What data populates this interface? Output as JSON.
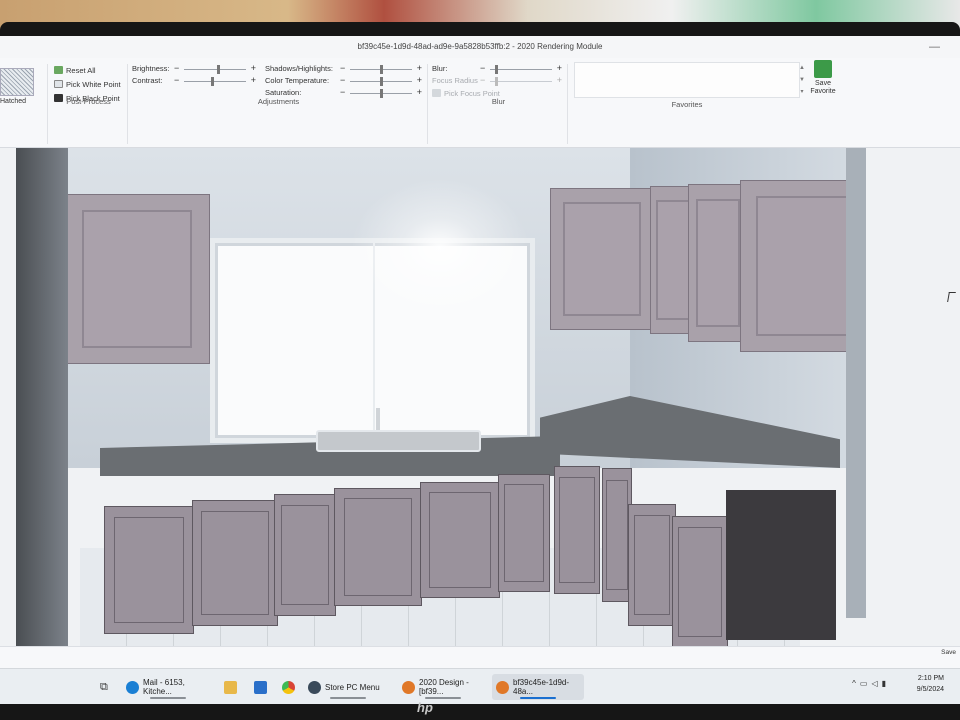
{
  "window": {
    "title": "bf39c45e-1d9d-48ad-ad9e-9a5828b53ffb:2 - 2020 Rendering Module"
  },
  "ribbon": {
    "hatched_label": "Hatched",
    "reset_all": "Reset All",
    "pick_white": "Pick White Point",
    "pick_black": "Pick Black Point",
    "postprocess_title": "Post-Process",
    "brightness": "Brightness:",
    "contrast": "Contrast:",
    "shadows": "Shadows/Highlights:",
    "color_temp": "Color Temperature:",
    "saturation": "Saturation:",
    "adjustments_title": "Adjustments",
    "blur": "Blur:",
    "focus_radius": "Focus Radius",
    "pick_focus": "Pick Focus Point",
    "blur_title": "Blur",
    "favorites_title": "Favorites",
    "save_favorite": "Save Favorite",
    "sign_minus": "−",
    "sign_plus": "+",
    "sliders": {
      "brightness": 0.55,
      "contrast": 0.45,
      "shadows": 0.5,
      "color_temp": 0.5,
      "saturation": 0.5,
      "blur": 0.1,
      "focus_radius": 0.1
    }
  },
  "status": {
    "save_label": "Save"
  },
  "taskbar": {
    "items": [
      {
        "label": "Mail - 6153, Kitche...",
        "icon": "edge-icon",
        "color": "#1a7fd4"
      },
      {
        "label": "",
        "icon": "folder-icon",
        "color": "#e8b84a"
      },
      {
        "label": "",
        "icon": "calculator-icon",
        "color": "#2a6fc9"
      },
      {
        "label": "",
        "icon": "chrome-icon",
        "color": "#d94436"
      },
      {
        "label": "Store PC Menu",
        "icon": "monitor-icon",
        "color": "#3a4a5a"
      },
      {
        "label": "2020 Design - [bf39...",
        "icon": "2020-icon",
        "color": "#e07828"
      },
      {
        "label": "bf39c45e-1d9d-48a...",
        "icon": "2020-icon",
        "color": "#e07828"
      }
    ],
    "time": "2:10 PM",
    "date": "9/5/2024"
  },
  "monitor": {
    "brand": "hp"
  }
}
